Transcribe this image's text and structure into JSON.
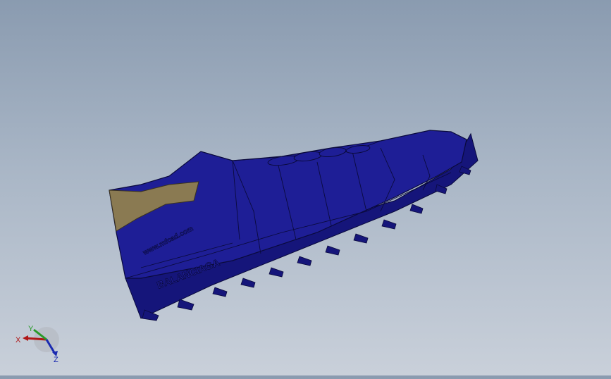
{
  "viewport": {
    "model_name": "shoe",
    "colors": {
      "background_top": "#8a9bb0",
      "background_bottom": "#c9d0da",
      "body": "#1e1e96",
      "body_dark": "#15157a",
      "edge": "#0a0a3c",
      "heel_collar": "#8a7a52"
    },
    "engravings": {
      "side": "www.mfcad.com",
      "sole": "BALANCIAGA"
    }
  },
  "triad": {
    "x_label": "X",
    "y_label": "Y",
    "z_label": "Z",
    "colors": {
      "x": "#b01818",
      "y": "#2a9a2a",
      "z": "#1a2ab0"
    }
  }
}
